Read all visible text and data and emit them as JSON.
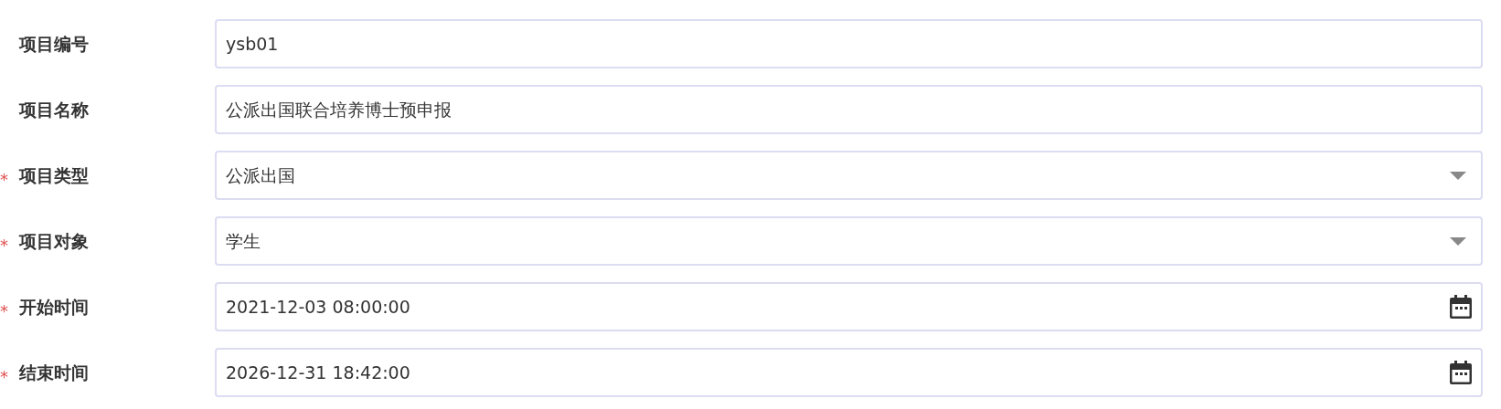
{
  "fields": [
    {
      "label": "项目编号",
      "kind": "text",
      "value": "ysb01"
    },
    {
      "label": "项目名称",
      "kind": "text",
      "value": "公派出国联合培养博士预申报"
    },
    {
      "required_mark": "*",
      "label": "项目类型",
      "kind": "select",
      "value": "公派出国"
    },
    {
      "required_mark": "*",
      "label": "项目对象",
      "kind": "select",
      "value": "学生"
    },
    {
      "required_mark": "*",
      "label": "开始时间",
      "kind": "datetime",
      "value": "2021-12-03 08:00:00"
    },
    {
      "required_mark": "*",
      "label": "结束时间",
      "kind": "datetime",
      "value": "2026-12-31 18:42:00"
    }
  ]
}
